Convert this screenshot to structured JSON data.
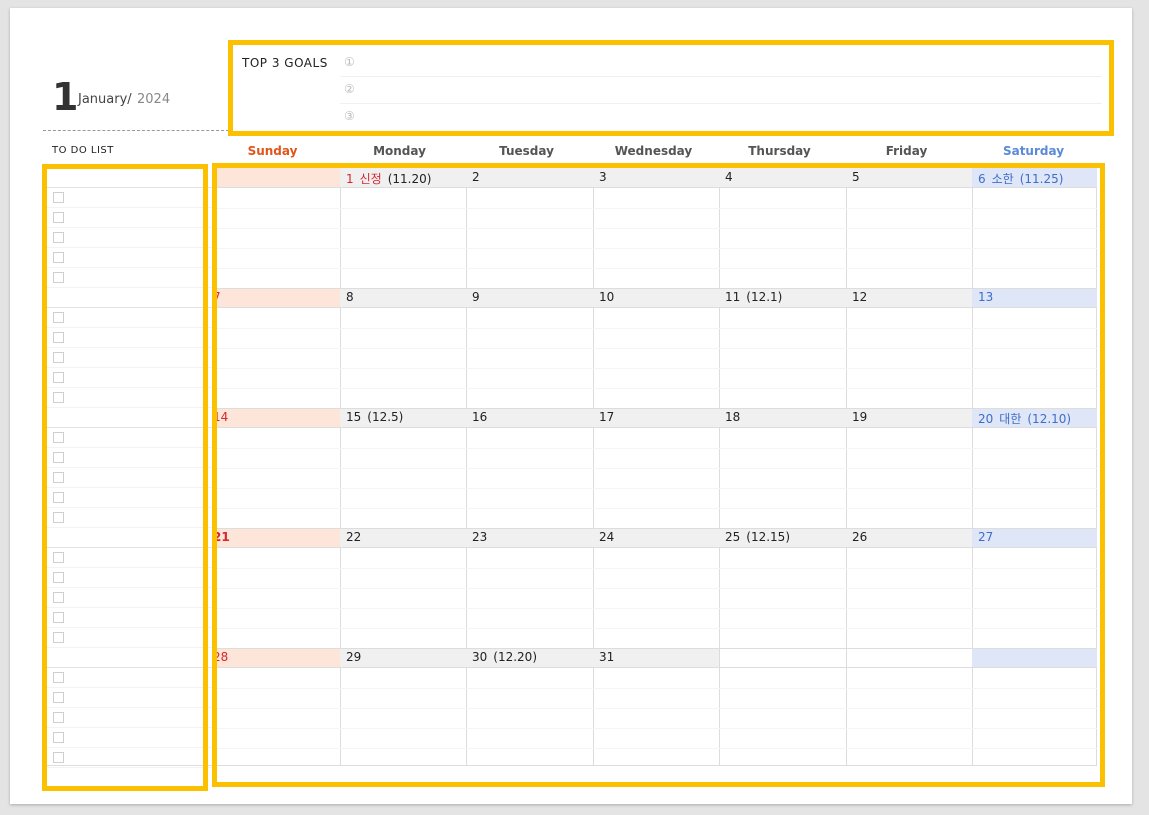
{
  "header": {
    "month_number": "1",
    "month_name": "January/",
    "year": "2024"
  },
  "goals": {
    "title": "TOP 3 GOALS",
    "markers": [
      "①",
      "②",
      "③"
    ]
  },
  "todo": {
    "title": "TO DO LIST"
  },
  "days": [
    "Sunday",
    "Monday",
    "Tuesday",
    "Wednesday",
    "Thursday",
    "Friday",
    "Saturday"
  ],
  "colors": {
    "sunday_text": "#e0551a",
    "saturday_text": "#5b8ad6",
    "highlight": "#fbc100"
  },
  "weeks": [
    [
      {
        "date": "",
        "note": ""
      },
      {
        "date": "1",
        "note": "신정",
        "lunar": "(11.20)",
        "holiday": true
      },
      {
        "date": "2",
        "note": "",
        "lunar": ""
      },
      {
        "date": "3",
        "note": "",
        "lunar": ""
      },
      {
        "date": "4",
        "note": "",
        "lunar": ""
      },
      {
        "date": "5",
        "note": "",
        "lunar": ""
      },
      {
        "date": "6",
        "note": "소한",
        "lunar": "(11.25)"
      }
    ],
    [
      {
        "date": "7",
        "note": "",
        "lunar": ""
      },
      {
        "date": "8",
        "note": "",
        "lunar": ""
      },
      {
        "date": "9",
        "note": "",
        "lunar": ""
      },
      {
        "date": "10",
        "note": "",
        "lunar": ""
      },
      {
        "date": "11",
        "note": "",
        "lunar": "(12.1)"
      },
      {
        "date": "12",
        "note": "",
        "lunar": ""
      },
      {
        "date": "13",
        "note": "",
        "lunar": ""
      }
    ],
    [
      {
        "date": "14",
        "note": "",
        "lunar": ""
      },
      {
        "date": "15",
        "note": "",
        "lunar": "(12.5)"
      },
      {
        "date": "16",
        "note": "",
        "lunar": ""
      },
      {
        "date": "17",
        "note": "",
        "lunar": ""
      },
      {
        "date": "18",
        "note": "",
        "lunar": ""
      },
      {
        "date": "19",
        "note": "",
        "lunar": ""
      },
      {
        "date": "20",
        "note": "대한",
        "lunar": "(12.10)"
      }
    ],
    [
      {
        "date": "21",
        "note": "",
        "lunar": ""
      },
      {
        "date": "22",
        "note": "",
        "lunar": ""
      },
      {
        "date": "23",
        "note": "",
        "lunar": ""
      },
      {
        "date": "24",
        "note": "",
        "lunar": ""
      },
      {
        "date": "25",
        "note": "",
        "lunar": "(12.15)"
      },
      {
        "date": "26",
        "note": "",
        "lunar": ""
      },
      {
        "date": "27",
        "note": "",
        "lunar": ""
      }
    ],
    [
      {
        "date": "28",
        "note": "",
        "lunar": ""
      },
      {
        "date": "29",
        "note": "",
        "lunar": ""
      },
      {
        "date": "30",
        "note": "",
        "lunar": "(12.20)"
      },
      {
        "date": "31",
        "note": "",
        "lunar": ""
      },
      {
        "date": "",
        "note": "",
        "lunar": ""
      },
      {
        "date": "",
        "note": "",
        "lunar": ""
      },
      {
        "date": "",
        "note": "",
        "lunar": ""
      }
    ]
  ]
}
